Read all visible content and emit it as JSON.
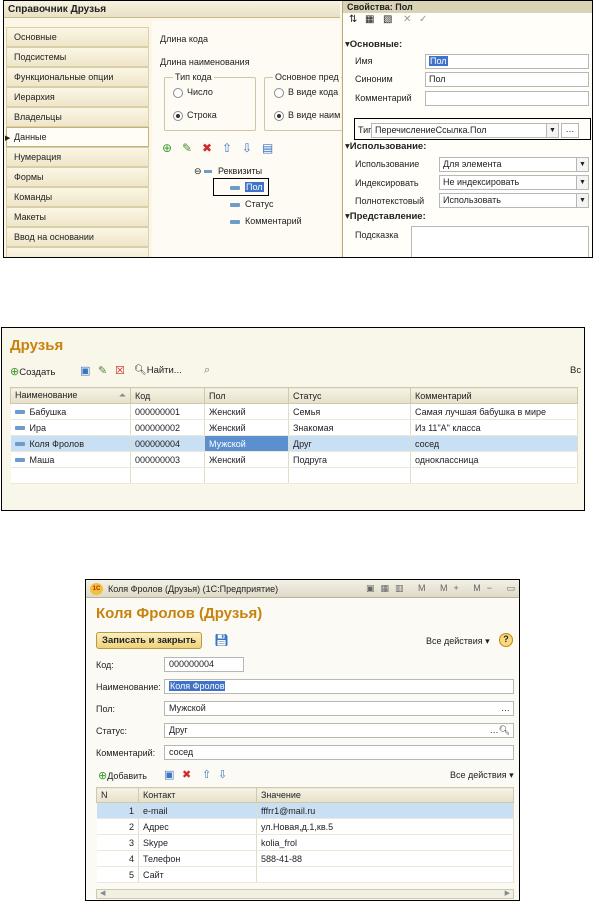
{
  "screen1": {
    "title": "Справочник Друзья",
    "nav": [
      "Основные",
      "Подсистемы",
      "Функциональные опции",
      "Иерархия",
      "Владельцы",
      "Данные",
      "Нумерация",
      "Формы",
      "Команды",
      "Макеты",
      "Ввод на основании"
    ],
    "nav_selected": "Данные",
    "mid": {
      "code_length": "Длина кода",
      "name_length": "Длина наименования",
      "code_type_group": "Тип кода",
      "main_view_group": "Основное пред",
      "number": "Число",
      "string": "Строка",
      "as_code": "В виде кода",
      "as_name": "В виде наим",
      "tree_root": "Реквизиты",
      "attributes": [
        "Пол",
        "Статус",
        "Комментарий"
      ]
    },
    "props": {
      "header": "Свойства: Пол",
      "sec_main": "Основные:",
      "name_label": "Имя",
      "name_value": "Пол",
      "synonym_label": "Синоним",
      "synonym_value": "Пол",
      "comment_label": "Комментарий",
      "type_label": "Тип",
      "type_value": "ПеречислениеСсылка.Пол",
      "sec_usage": "Использование:",
      "usage_label": "Использование",
      "usage_value": "Для элемента",
      "index_label": "Индексировать",
      "index_value": "Не индексировать",
      "fulltext_label": "Полнотекстовый",
      "fulltext_value": "Использовать",
      "sec_view": "Представление:",
      "hint_label": "Подсказка"
    }
  },
  "screen2": {
    "title": "Друзья",
    "toolbar": {
      "create": "Создать",
      "find": "Найти...",
      "right": "Вс"
    },
    "columns": [
      "Наименование",
      "Код",
      "Пол",
      "Статус",
      "Комментарий"
    ],
    "rows": [
      [
        "Бабушка",
        "000000001",
        "Женский",
        "Семья",
        "Самая лучшая бабушка в мире"
      ],
      [
        "Ира",
        "000000002",
        "Женский",
        "Знакомая",
        "Из 11\"А\" класса"
      ],
      [
        "Коля Фролов",
        "000000004",
        "Мужской",
        "Друг",
        "сосед"
      ],
      [
        "Маша",
        "000000003",
        "Женский",
        "Подруга",
        "одноклассница"
      ]
    ],
    "selected_row": 2
  },
  "screen3": {
    "window_title": "Коля Фролов (Друзья)  (1С:Предприятие)",
    "title": "Коля Фролов (Друзья)",
    "save_close": "Записать и закрыть",
    "all_actions": "Все действия ▾",
    "code_label": "Код:",
    "code_value": "000000004",
    "name_label": "Наименование:",
    "name_value": "Коля Фролов",
    "gender_label": "Пол:",
    "gender_value": "Мужской",
    "status_label": "Статус:",
    "status_value": "Друг",
    "comment_label": "Комментарий:",
    "comment_value": "сосед",
    "add": "Добавить",
    "table_cols": [
      "N",
      "Контакт",
      "Значение"
    ],
    "contacts": [
      [
        "1",
        "e-mail",
        "fffrr1@mail.ru"
      ],
      [
        "2",
        "Адрес",
        "ул.Новая,д.1,кв.5"
      ],
      [
        "3",
        "Skype",
        "kolia_frol"
      ],
      [
        "4",
        "Телефон",
        "588-41-88"
      ],
      [
        "5",
        "Сайт",
        ""
      ]
    ]
  }
}
